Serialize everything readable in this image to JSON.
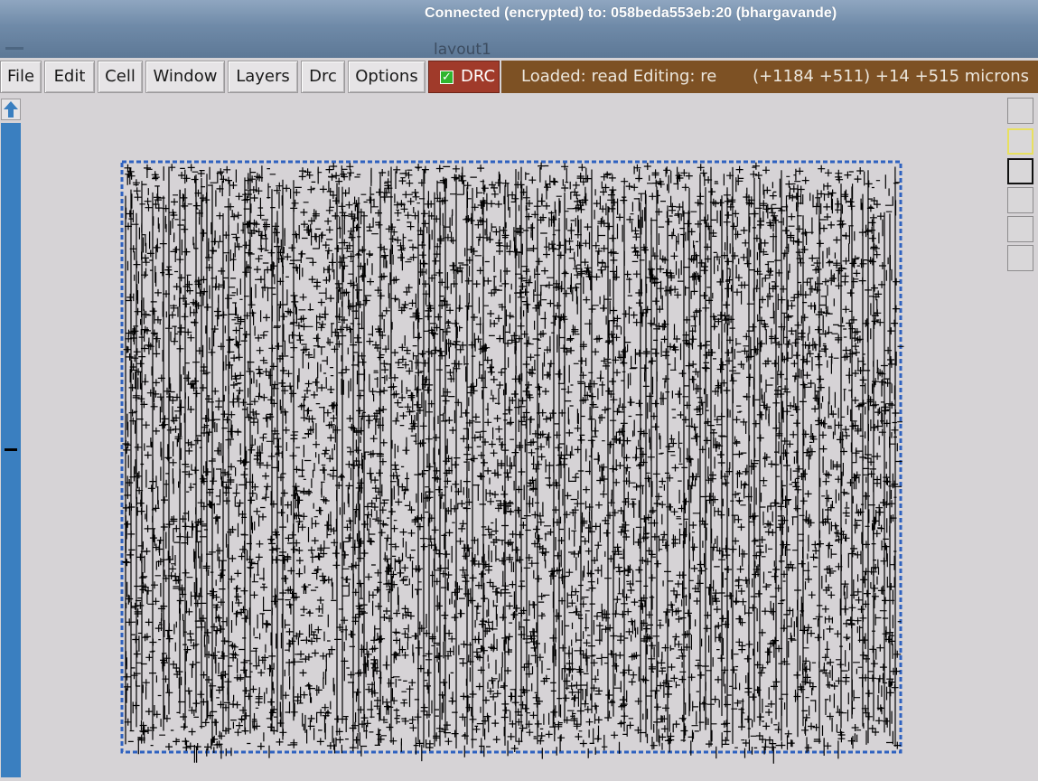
{
  "titlebar": {
    "connection_text": "Connected (encrypted) to: 058beda553eb:20 (bhargavande)",
    "window_title": "layout1"
  },
  "menu": {
    "items": [
      {
        "label": "File"
      },
      {
        "label": "Edit"
      },
      {
        "label": "Cell"
      },
      {
        "label": "Window"
      },
      {
        "label": "Layers"
      },
      {
        "label": "Drc"
      },
      {
        "label": "Options"
      }
    ],
    "drc_toggle": {
      "label": "DRC",
      "checked": true,
      "check_glyph": "✓"
    }
  },
  "status": {
    "loaded_editing": "Loaded: read Editing: re",
    "coordinates": "(+1184 +511) +14 +515 microns"
  },
  "colors": {
    "status_bg": "#7d5124",
    "drc_bg": "#a03a2a",
    "scrollbar": "#3a7fc0",
    "layout_boundary": "#2f62c0",
    "layout_ink": "#000000",
    "canvas_bg": "#d6d3d6"
  },
  "icons": {
    "scroll_up": "arrow-up-icon",
    "tool_1": "blank-tool-icon",
    "tool_2": "yellow-box-tool-icon",
    "tool_3": "black-box-tool-icon",
    "tool_4": "blank-tool-icon",
    "tool_5": "blank-tool-icon",
    "tool_6": "blank-tool-icon"
  }
}
